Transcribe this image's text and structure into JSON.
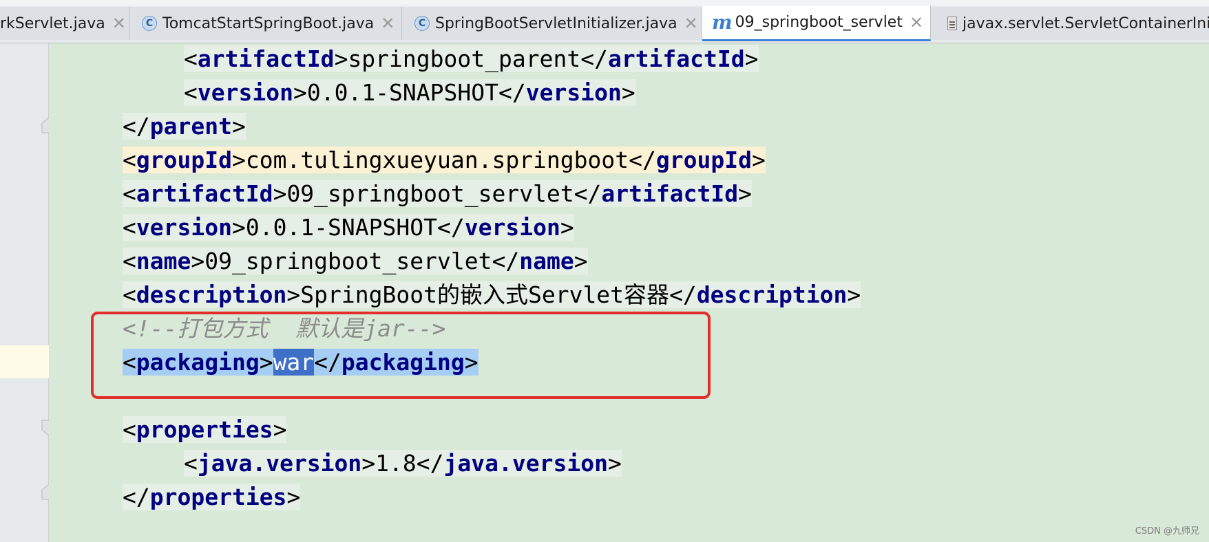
{
  "tabs": [
    {
      "label": "rkServlet.java",
      "icon": "none",
      "active": false
    },
    {
      "label": "TomcatStartSpringBoot.java",
      "icon": "class-icon",
      "active": false
    },
    {
      "label": "SpringBootServletInitializer.java",
      "icon": "class-icon",
      "active": false
    },
    {
      "label": "09_springboot_servlet",
      "icon": "maven-icon",
      "active": true
    },
    {
      "label": "javax.servlet.ServletContainerInit",
      "icon": "file-icon",
      "active": false
    }
  ],
  "code": {
    "l1": {
      "open": "artifactId",
      "value": "springboot_parent",
      "close": "artifactId"
    },
    "l2": {
      "open": "version",
      "value": "0.0.1-SNAPSHOT",
      "close": "version"
    },
    "l3": {
      "close": "parent"
    },
    "l4": {
      "open": "groupId",
      "value": "com.tulingxueyuan.springboot",
      "close": "groupId"
    },
    "l5": {
      "open": "artifactId",
      "value": "09_springboot_servlet",
      "close": "artifactId"
    },
    "l6": {
      "open": "version",
      "value": "0.0.1-SNAPSHOT",
      "close": "version"
    },
    "l7": {
      "open": "name",
      "value": "09_springboot_servlet",
      "close": "name"
    },
    "l8": {
      "open": "description",
      "value": "SpringBoot的嵌入式Servlet容器",
      "close": "description"
    },
    "l9": {
      "comment": "<!--打包方式  默认是jar-->"
    },
    "l10": {
      "open": "packaging",
      "value": "war",
      "close": "packaging"
    },
    "l11": {
      "open": "properties"
    },
    "l12": {
      "open": "java.version",
      "value": "1.8",
      "close": "java.version"
    },
    "l13": {
      "close": "properties"
    }
  },
  "watermark": "CSDN @九师兄",
  "colors": {
    "tag": "#000080",
    "comment": "#8c8c8c",
    "highlight_box": "#e0302c",
    "selection": "#a6cdf3"
  }
}
